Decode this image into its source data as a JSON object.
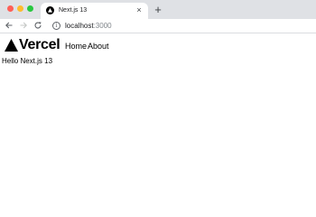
{
  "browser": {
    "tab": {
      "title": "Next.js 13",
      "favicon": "vercel-triangle-icon",
      "close_glyph": "×"
    },
    "new_tab_glyph": "+",
    "toolbar": {
      "back_icon": "arrow-left-icon",
      "forward_icon": "arrow-right-icon",
      "reload_icon": "reload-icon",
      "info_icon": "info-icon",
      "url_host": "localhost",
      "url_port": ":3000"
    },
    "colors": {
      "tabstrip": "#dfe1e5",
      "close_dot": "#ff5f57",
      "minimize_dot": "#febc2e",
      "maximize_dot": "#28c840"
    }
  },
  "page": {
    "logo_text": "Vercel",
    "logo_icon": "vercel-triangle-icon",
    "nav": {
      "home": "Home",
      "about": "About"
    },
    "greeting": "Hello Next.js 13"
  }
}
